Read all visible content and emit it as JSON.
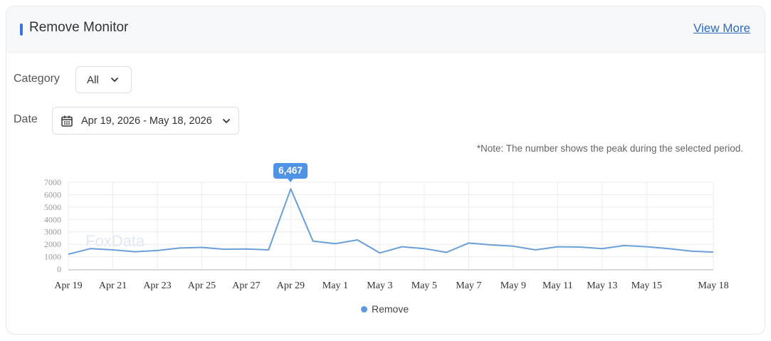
{
  "header": {
    "title": "Remove Monitor",
    "view_more": "View More"
  },
  "filters": {
    "category_label": "Category",
    "category_value": "All",
    "date_label": "Date",
    "date_value": "Apr 19, 2026 - May 18, 2026"
  },
  "note": "*Note: The number shows the peak during the selected period.",
  "watermark": "FoxData",
  "chart_data": {
    "type": "line",
    "series": [
      {
        "name": "Remove",
        "color": "#6a9fd8",
        "values": [
          1200,
          1650,
          1550,
          1400,
          1500,
          1700,
          1750,
          1600,
          1620,
          1550,
          6467,
          2250,
          2050,
          2350,
          1300,
          1800,
          1650,
          1350,
          2100,
          1950,
          1850,
          1550,
          1800,
          1780,
          1650,
          1900,
          1800,
          1650,
          1450,
          1370
        ]
      }
    ],
    "x": [
      "Apr 19",
      "Apr 20",
      "Apr 21",
      "Apr 22",
      "Apr 23",
      "Apr 24",
      "Apr 25",
      "Apr 26",
      "Apr 27",
      "Apr 28",
      "Apr 29",
      "Apr 30",
      "May 1",
      "May 2",
      "May 3",
      "May 4",
      "May 5",
      "May 6",
      "May 7",
      "May 8",
      "May 9",
      "May 10",
      "May 11",
      "May 12",
      "May 13",
      "May 14",
      "May 15",
      "May 16",
      "May 17",
      "May 18"
    ],
    "x_tick_labels": [
      "Apr 19",
      "Apr 21",
      "Apr 23",
      "Apr 25",
      "Apr 27",
      "Apr 29",
      "May 1",
      "May 3",
      "May 5",
      "May 7",
      "May 9",
      "May 11",
      "May 13",
      "May 15",
      "May 18"
    ],
    "y_ticks": [
      0,
      1000,
      2000,
      3000,
      4000,
      5000,
      6000,
      7000
    ],
    "ylim": [
      0,
      7000
    ],
    "peak_label": "6,467",
    "grid": true,
    "legend": "bottom-center"
  }
}
